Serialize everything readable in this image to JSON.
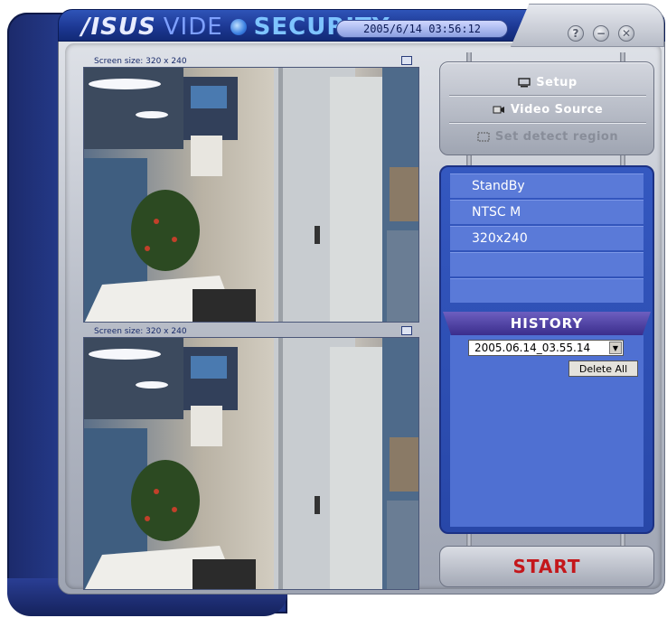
{
  "window": {
    "brand_asus": "/ISUS",
    "brand_video": "VIDE",
    "brand_security": "SECURITY",
    "datetime": "2005/6/14  03:56:12",
    "controls": [
      "help-icon",
      "minimize-icon",
      "close-icon"
    ],
    "control_glyphs": {
      "help": "?",
      "minimize": "−",
      "close": "✕"
    }
  },
  "panes": [
    {
      "label": "Screen size: 320 x 240"
    },
    {
      "label": "Screen size: 320 x 240"
    }
  ],
  "menu": {
    "setup": "Setup",
    "video_source": "Video Source",
    "detect_region": "Set detect region"
  },
  "status": {
    "rows": [
      "StandBy",
      "NTSC M",
      "320x240",
      "",
      ""
    ]
  },
  "history": {
    "title": "HISTORY",
    "selected": "2005.06.14_03.55.14",
    "delete_all": "Delete All"
  },
  "start_label": "START",
  "colors": {
    "accent_blue": "#2847a8",
    "start_red": "#c4171b"
  }
}
